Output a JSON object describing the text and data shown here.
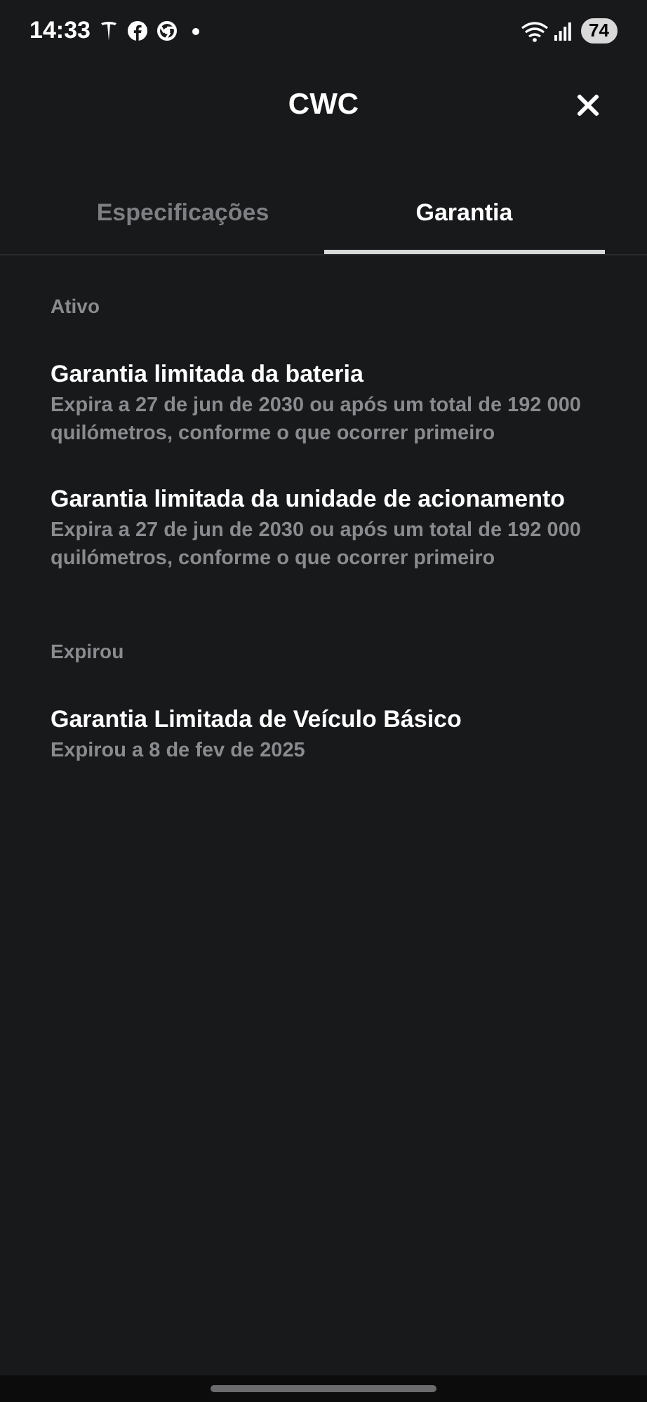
{
  "status_bar": {
    "time": "14:33",
    "battery": "74"
  },
  "header": {
    "title": "CWC"
  },
  "tabs": [
    {
      "label": "Especificações",
      "selected": false
    },
    {
      "label": "Garantia",
      "selected": true
    }
  ],
  "sections": [
    {
      "heading": "Ativo",
      "items": [
        {
          "title": "Garantia limitada da bateria",
          "detail": "Expira a 27 de jun de 2030 ou após um total de 192 000 quilómetros, conforme o que ocorrer primeiro"
        },
        {
          "title": "Garantia limitada da unidade de acionamento",
          "detail": "Expira a 27 de jun de 2030 ou após um total de 192 000 quilómetros, conforme o que ocorrer primeiro"
        }
      ]
    },
    {
      "heading": "Expirou",
      "items": [
        {
          "title": "Garantia Limitada de Veículo Básico",
          "detail": "Expirou a 8 de fev de 2025"
        }
      ]
    }
  ]
}
